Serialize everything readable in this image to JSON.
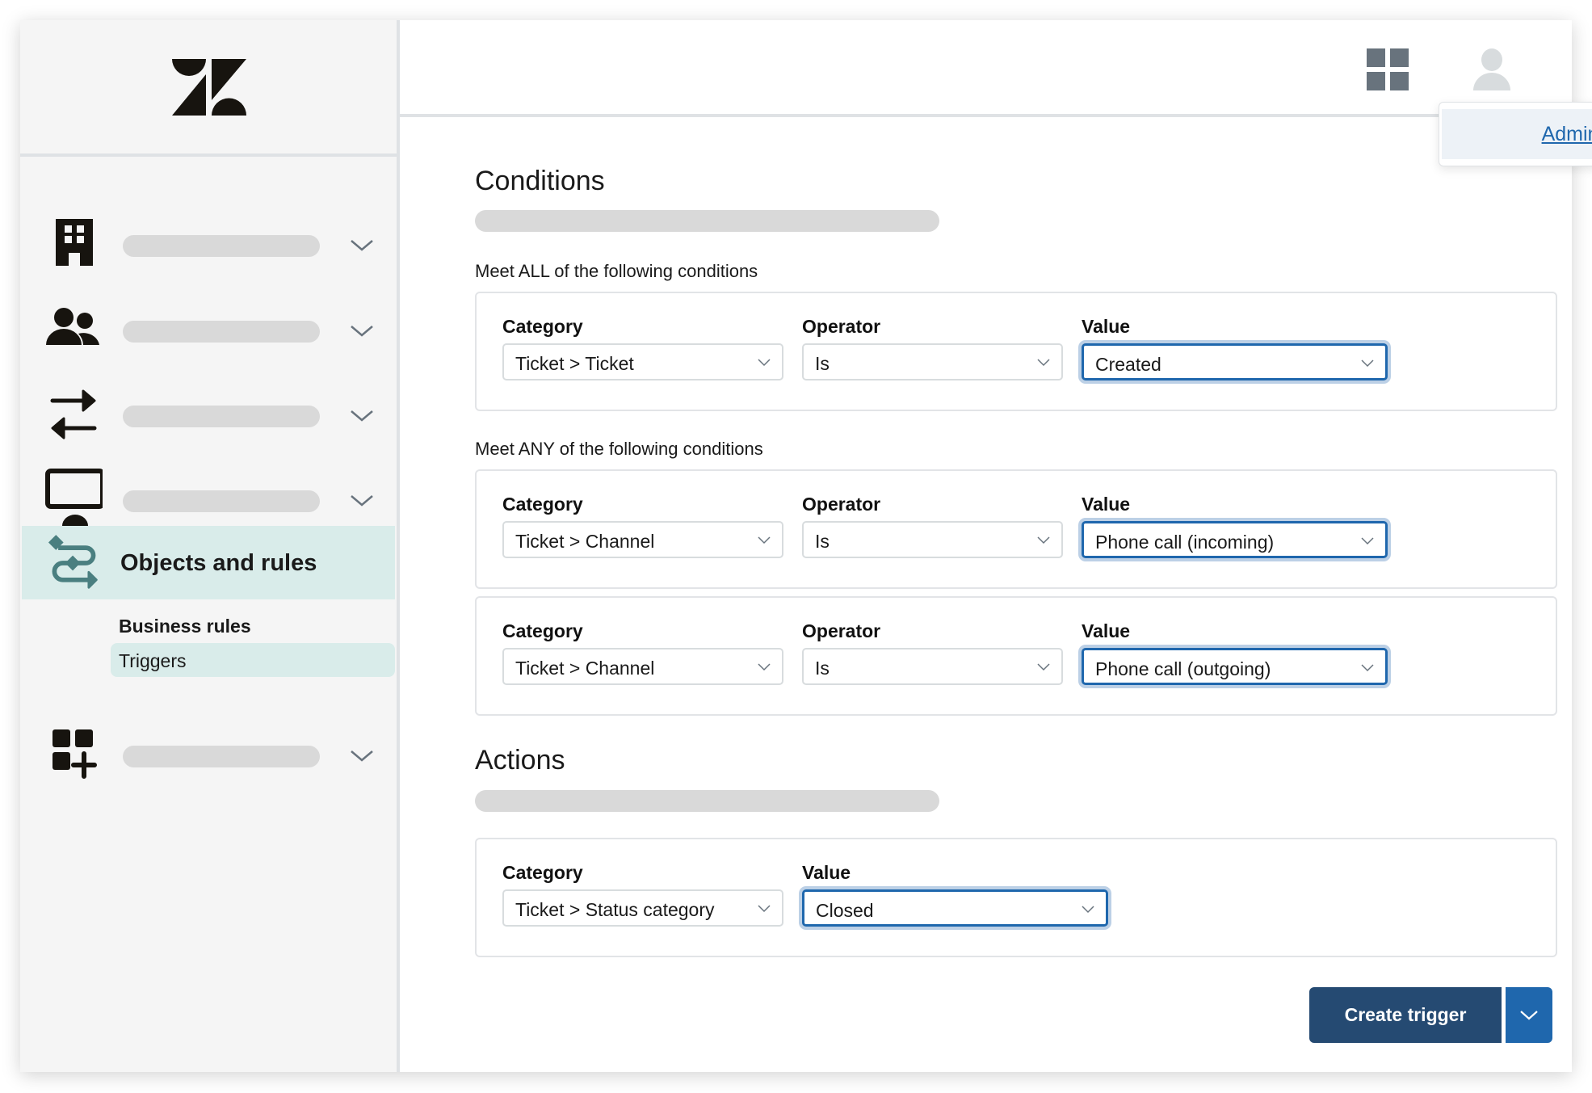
{
  "brand": {
    "logo": "zendesk-logo"
  },
  "colors": {
    "accent": "#1f67ad",
    "primary_button": "#254a72",
    "active_nav_bg": "#d9ecea",
    "active_nav_icon": "#4a7f80",
    "link": "#1f67ad"
  },
  "sidebar": {
    "items": [
      {
        "icon": "building-icon",
        "label": ""
      },
      {
        "icon": "users-icon",
        "label": ""
      },
      {
        "icon": "transfer-arrows-icon",
        "label": ""
      },
      {
        "icon": "monitor-icon",
        "label": ""
      },
      {
        "icon": "objects-rules-icon",
        "label": "Objects and rules",
        "active": true,
        "children": [
          {
            "label": "Business rules"
          },
          {
            "label": "Triggers",
            "active": true
          }
        ]
      },
      {
        "icon": "apps-add-icon",
        "label": ""
      }
    ]
  },
  "topbar": {
    "apps_icon": "grid-icon",
    "user_icon": "user-avatar-icon",
    "popup": {
      "link_label": "Admin Center"
    }
  },
  "conditions": {
    "title": "Conditions",
    "all": {
      "label": "Meet ALL of the following conditions",
      "rows": [
        {
          "category_label": "Category",
          "category": "Ticket > Ticket",
          "operator_label": "Operator",
          "operator": "Is",
          "value_label": "Value",
          "value": "Created"
        }
      ]
    },
    "any": {
      "label": "Meet ANY of the following conditions",
      "rows": [
        {
          "category_label": "Category",
          "category": "Ticket > Channel",
          "operator_label": "Operator",
          "operator": "Is",
          "value_label": "Value",
          "value": "Phone call (incoming)"
        },
        {
          "category_label": "Category",
          "category": "Ticket > Channel",
          "operator_label": "Operator",
          "operator": "Is",
          "value_label": "Value",
          "value": "Phone call (outgoing)"
        }
      ]
    }
  },
  "actions": {
    "title": "Actions",
    "rows": [
      {
        "category_label": "Category",
        "category": "Ticket > Status category",
        "value_label": "Value",
        "value": "Closed"
      }
    ]
  },
  "footer": {
    "create_label": "Create trigger"
  }
}
